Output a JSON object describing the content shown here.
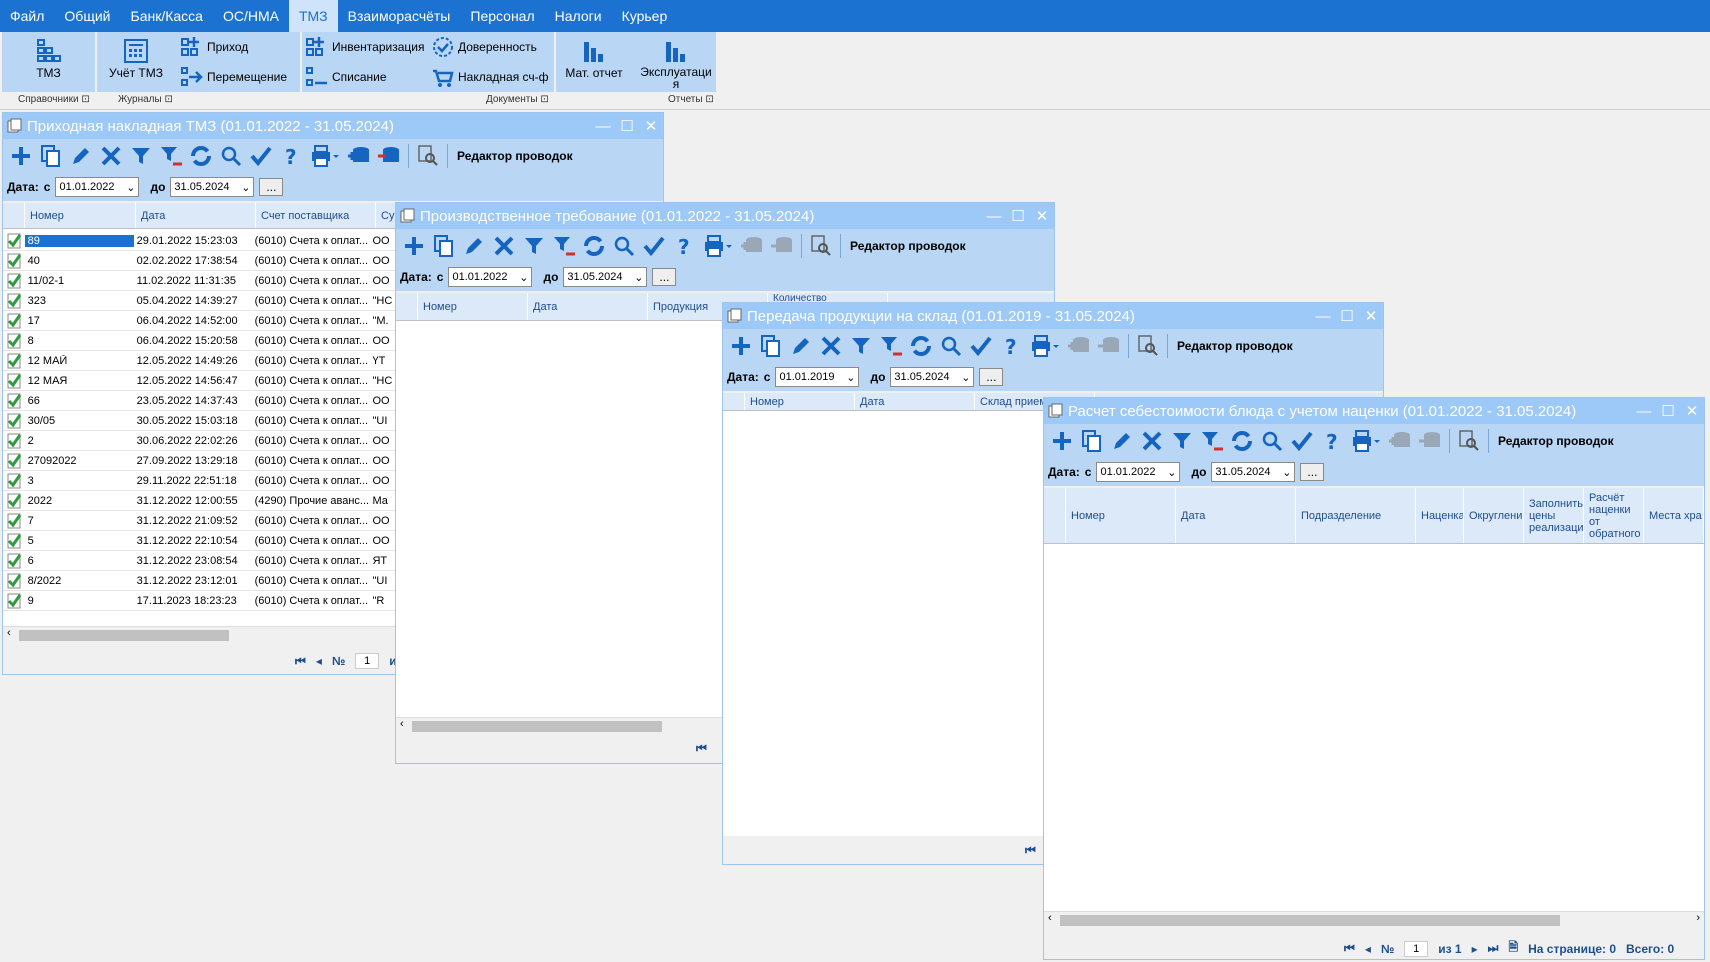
{
  "menu": [
    "Файл",
    "Общий",
    "Банк/Касса",
    "ОС/НМА",
    "ТМЗ",
    "Взаиморасчёты",
    "Персонал",
    "Налоги",
    "Курьер"
  ],
  "menu_active": "ТМЗ",
  "ribbon": {
    "tmz": "ТМЗ",
    "uchet": "Учёт ТМЗ",
    "prihod": "Приход",
    "peremeshenie": "Перемещение",
    "inventarizaciya": "Инвентаризация",
    "spisanie": "Списание",
    "doverennost": "Доверенность",
    "nakladnaya": "Накладная сч-ф",
    "mat_otchet": "Мат. отчет",
    "ekspluataciya": "Эксплуатаци я",
    "groups": [
      "Справочники",
      "Журналы",
      "Документы",
      "Отчеты"
    ]
  },
  "common": {
    "toolbar_label": "Редактор проводок",
    "date_label": "Дата:",
    "from_label": "с",
    "to_label": "до",
    "dots": "...",
    "no_label": "№"
  },
  "win1": {
    "title": "Приходная накладная ТМЗ (01.01.2022 - 31.05.2024)",
    "date_from": "01.01.2022",
    "date_to": "31.05.2024",
    "columns": [
      "Номер",
      "Дата",
      "Счет поставщика",
      "Су"
    ],
    "rows": [
      [
        "89",
        "29.01.2022 15:23:03",
        "(6010) Счета к оплат...",
        "ОО"
      ],
      [
        "40",
        "02.02.2022 17:38:54",
        "(6010) Счета к оплат...",
        "ОО"
      ],
      [
        "11/02-1",
        "11.02.2022 11:31:35",
        "(6010) Счета к оплат...",
        "ОО"
      ],
      [
        "323",
        "05.04.2022 14:39:27",
        "(6010) Счета к оплат...",
        "\"НС"
      ],
      [
        "17",
        "06.04.2022 14:52:00",
        "(6010) Счета к оплат...",
        "\"М."
      ],
      [
        "8",
        "06.04.2022 15:20:58",
        "(6010) Счета к оплат...",
        "ОО"
      ],
      [
        "12 МАЙ",
        "12.05.2022 14:49:26",
        "(6010) Счета к оплат...",
        "ҮТ"
      ],
      [
        "12 МАЯ",
        "12.05.2022 14:56:47",
        "(6010) Счета к оплат...",
        "\"НС"
      ],
      [
        "66",
        "23.05.2022 14:37:43",
        "(6010) Счета к оплат...",
        "ОО"
      ],
      [
        "30/05",
        "30.05.2022 15:03:18",
        "(6010) Счета к оплат...",
        "\"UI"
      ],
      [
        "2",
        "30.06.2022 22:02:26",
        "(6010) Счета к оплат...",
        "ОО"
      ],
      [
        "27092022",
        "27.09.2022 13:29:18",
        "(6010) Счета к оплат...",
        "ОО"
      ],
      [
        "3",
        "29.11.2022 22:51:18",
        "(6010) Счета к оплат...",
        "ОО"
      ],
      [
        "2022",
        "31.12.2022 12:00:55",
        "(4290) Прочие аванс...",
        "Ма"
      ],
      [
        "7",
        "31.12.2022 21:09:52",
        "(6010) Счета к оплат...",
        "ОО"
      ],
      [
        "5",
        "31.12.2022 22:10:54",
        "(6010) Счета к оплат...",
        "ОО"
      ],
      [
        "6",
        "31.12.2022 23:08:54",
        "(6010) Счета к оплат...",
        "ЯТ"
      ],
      [
        "8/2022",
        "31.12.2022 23:12:01",
        "(6010) Счета к оплат...",
        "\"UI"
      ],
      [
        "9",
        "17.11.2023 18:23:23",
        "(6010) Счета к оплат...",
        "\"R"
      ]
    ],
    "page": "1",
    "page_of_trunc": "и"
  },
  "win2": {
    "title": "Производственное требование (01.01.2022 - 31.05.2024)",
    "date_from": "01.01.2022",
    "date_to": "31.05.2024",
    "columns": [
      "Номер",
      "Дата",
      "Продукция"
    ],
    "hidden_col": "Количество"
  },
  "win3": {
    "title": "Передача продукции на склад (01.01.2019 - 31.05.2024)",
    "date_from": "01.01.2019",
    "date_to": "31.05.2024",
    "columns": [
      "Номер",
      "Дата",
      "Склад прием"
    ]
  },
  "win4": {
    "title": "Расчет себестоимости блюда с учетом наценки (01.01.2022 - 31.05.2024)",
    "date_from": "01.01.2022",
    "date_to": "31.05.2024",
    "columns": [
      "Номер",
      "Дата",
      "Подразделение",
      "Наценка",
      "Округлени",
      "Заполнить цены реализаци",
      "Расчёт наценки от обратного",
      "Места хра"
    ],
    "page": "1",
    "of": "из 1",
    "on_page": "На странице: 0",
    "total": "Всего: 0"
  },
  "colors": {
    "menubar": "#1b72d0",
    "title": "#9cc9f7",
    "toolbar": "#b9d6f5",
    "icon": "#1565c0",
    "check": "#2e9b3c"
  }
}
